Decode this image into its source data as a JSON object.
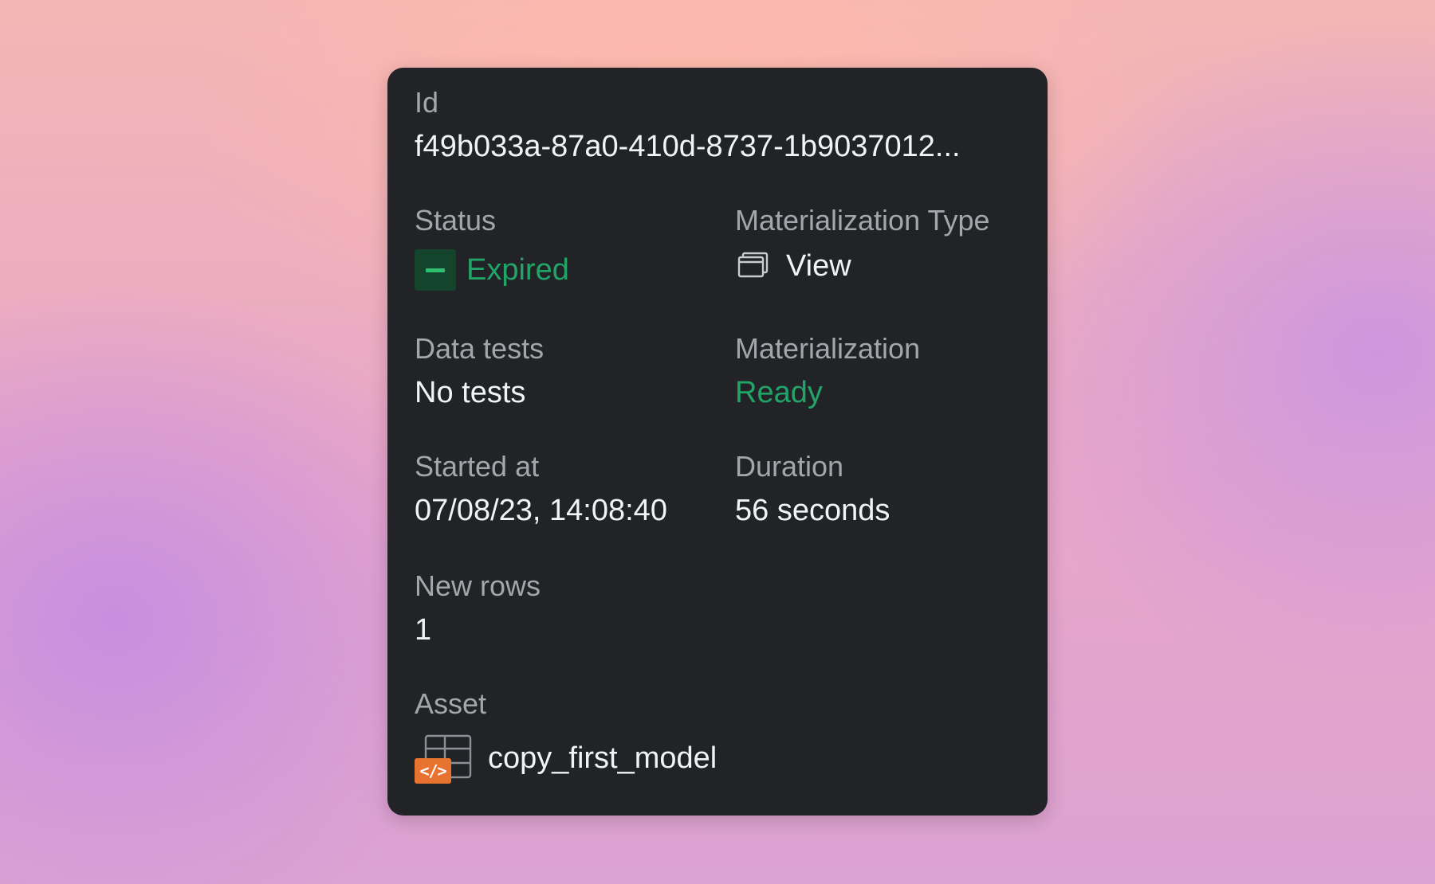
{
  "panel": {
    "id": {
      "label": "Id",
      "value": "f49b033a-87a0-410d-8737-1b9037012..."
    },
    "status": {
      "label": "Status",
      "value": "Expired",
      "icon": "minus-icon",
      "color": "#22a468"
    },
    "materialization_type": {
      "label": "Materialization Type",
      "value": "View",
      "icon": "view-icon"
    },
    "data_tests": {
      "label": "Data tests",
      "value": "No tests"
    },
    "materialization": {
      "label": "Materialization",
      "value": "Ready",
      "color": "#22a468"
    },
    "started_at": {
      "label": "Started at",
      "value": "07/08/23, 14:08:40"
    },
    "duration": {
      "label": "Duration",
      "value": "56 seconds"
    },
    "new_rows": {
      "label": "New rows",
      "value": "1"
    },
    "asset": {
      "label": "Asset",
      "value": "copy_first_model",
      "icon": "table-model-icon",
      "badge": "</>"
    }
  },
  "colors": {
    "card_background": "#222327",
    "accent_green": "#22a468",
    "badge_orange": "#e8722f"
  }
}
